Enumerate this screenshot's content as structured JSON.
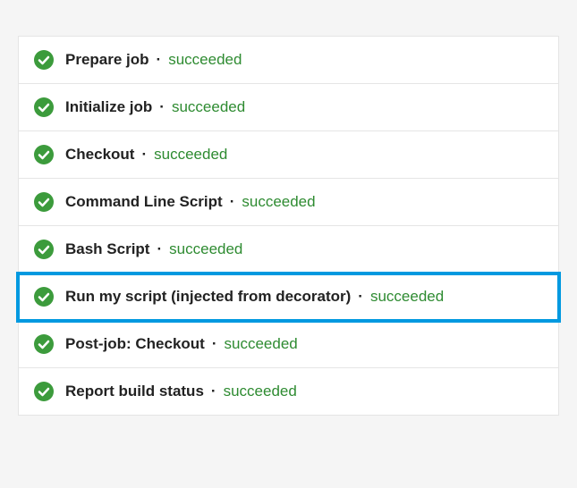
{
  "steps": [
    {
      "label": "Prepare job",
      "status": "succeeded",
      "highlighted": false
    },
    {
      "label": "Initialize job",
      "status": "succeeded",
      "highlighted": false
    },
    {
      "label": "Checkout",
      "status": "succeeded",
      "highlighted": false
    },
    {
      "label": "Command Line Script",
      "status": "succeeded",
      "highlighted": false
    },
    {
      "label": "Bash Script",
      "status": "succeeded",
      "highlighted": false
    },
    {
      "label": "Run my script (injected from decorator)",
      "status": "succeeded",
      "highlighted": true
    },
    {
      "label": "Post-job: Checkout",
      "status": "succeeded",
      "highlighted": false
    },
    {
      "label": "Report build status",
      "status": "succeeded",
      "highlighted": false
    }
  ],
  "separator": "·",
  "colors": {
    "success": "#3c9b3c",
    "highlight": "#0099e0"
  }
}
